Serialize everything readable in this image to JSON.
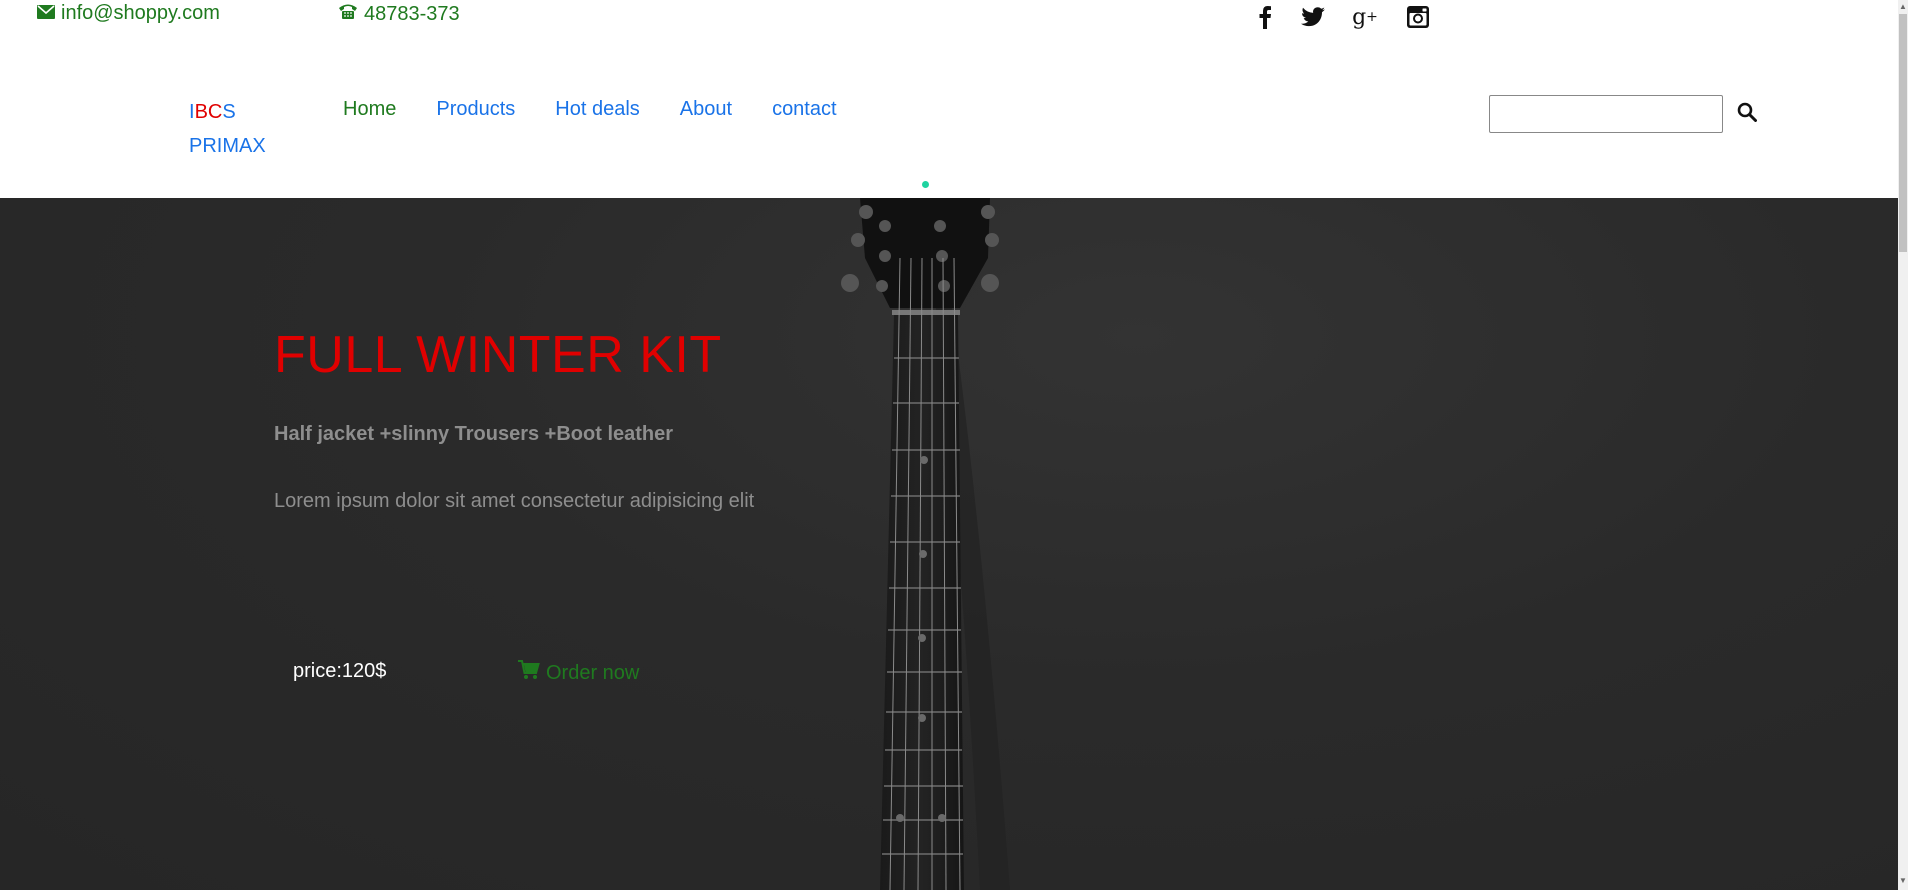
{
  "topbar": {
    "email": "info@shoppy.com",
    "phone": "48783-373",
    "social": [
      {
        "name": "facebook-icon",
        "glyph": "f"
      },
      {
        "name": "twitter-icon"
      },
      {
        "name": "google-plus-icon",
        "glyph": "g+"
      },
      {
        "name": "instagram-icon"
      }
    ]
  },
  "logo": {
    "line1_a": "I",
    "line1_b": "BC",
    "line1_c": "S",
    "line2": "PRIMAX"
  },
  "nav": {
    "items": [
      {
        "label": "Home",
        "active": true
      },
      {
        "label": "Products"
      },
      {
        "label": "Hot deals"
      },
      {
        "label": "About"
      },
      {
        "label": "contact"
      }
    ],
    "search_placeholder": ""
  },
  "hero": {
    "title": "FULL WINTER KIT",
    "subtitle": "Half jacket +slinny Trousers +Boot leather",
    "description": "Lorem ipsum dolor sit amet consectetur adipisicing elit",
    "price": "price:120$",
    "order": "Order now"
  },
  "colors": {
    "accent_green": "#1f7a1f",
    "link_blue": "#1a73e8",
    "title_red": "#e00000",
    "hero_bg": "#2b2b2b",
    "indicator_teal": "#1fd3a0"
  }
}
